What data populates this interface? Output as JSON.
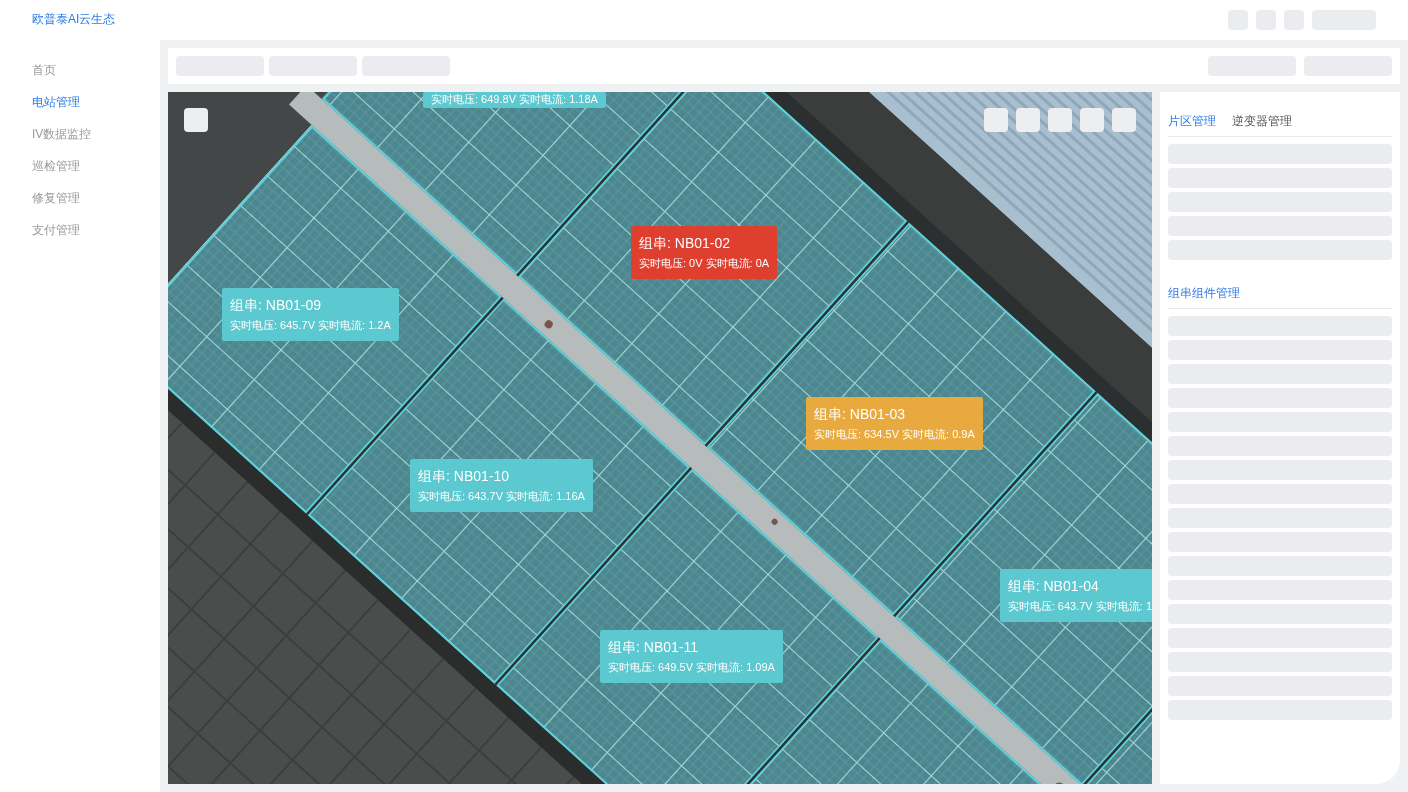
{
  "header": {
    "logo": "欧普泰AI云生态"
  },
  "sidebar": {
    "items": [
      {
        "label": "首页",
        "selected": false
      },
      {
        "label": "电站管理",
        "selected": true
      },
      {
        "label": "IV数据监控",
        "selected": false
      },
      {
        "label": "巡检管理",
        "selected": false
      },
      {
        "label": "修复管理",
        "selected": false
      },
      {
        "label": "支付管理",
        "selected": false
      }
    ]
  },
  "map": {
    "strings": [
      {
        "reading": "实时电压: 649.8V 实时电流: 1.18A",
        "color": "#5cc8cf"
      },
      {
        "title": "组串: NB01-02",
        "reading": "实时电压: 0V 实时电流: 0A",
        "color": "#df3f2f"
      },
      {
        "title": "组串: NB01-09",
        "reading": "实时电压: 645.7V 实时电流: 1.2A",
        "color": "#5cc8cf"
      },
      {
        "title": "组串: NB01-03",
        "reading": "实时电压: 634.5V 实时电流: 0.9A",
        "color": "#e8aa3f"
      },
      {
        "title": "组串: NB01-10",
        "reading": "实时电压: 643.7V 实时电流: 1.16A",
        "color": "#5cc8cf"
      },
      {
        "title": "组串: NB01-04",
        "reading": "实时电压: 643.7V 实时电流: 1",
        "color": "#5cc8cf"
      },
      {
        "title": "组串: NB01-11",
        "reading": "实时电压: 649.5V 实时电流: 1.09A",
        "color": "#5cc8cf"
      }
    ]
  },
  "panel": {
    "tabs": [
      {
        "label": "片区管理",
        "selected": true
      },
      {
        "label": "逆变器管理",
        "selected": false
      }
    ],
    "section_title": "组串组件管理"
  }
}
